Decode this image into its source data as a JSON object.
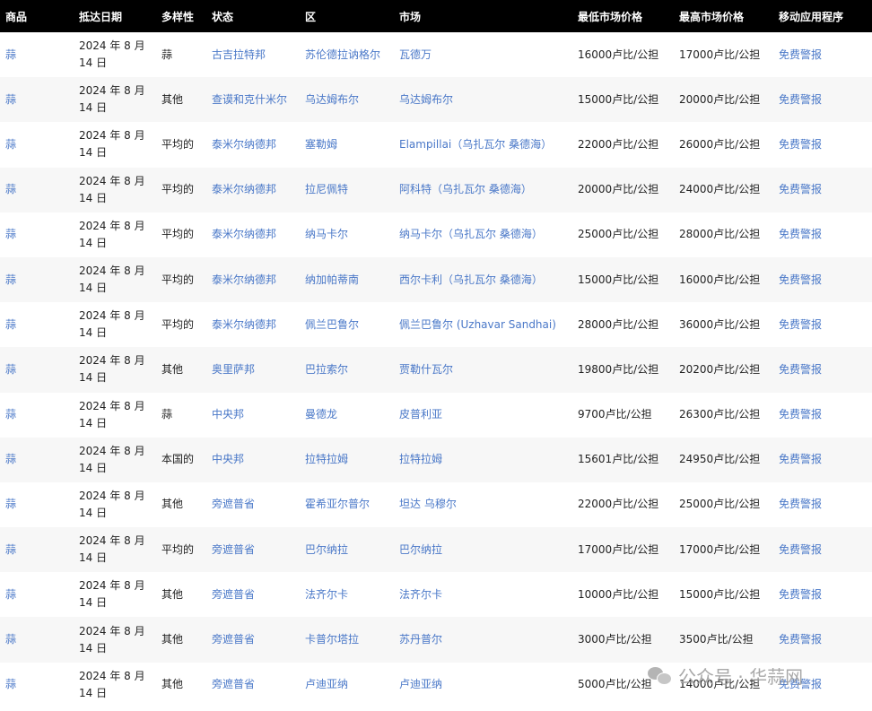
{
  "table": {
    "headers": {
      "commodity": "商品",
      "arrival_date": "抵达日期",
      "variety": "多样性",
      "state": "状态",
      "district": "区",
      "market": "市场",
      "min_price": "最低市场价格",
      "max_price": "最高市场价格",
      "mobile_app": "移动应用程序"
    },
    "rows": [
      {
        "commodity": "蒜",
        "arrival_date": "2024 年 8 月 14 日",
        "variety": "蒜",
        "state": "古吉拉特邦",
        "district": "苏伦德拉讷格尔",
        "market": "瓦德万",
        "min_price": "16000卢比/公担",
        "max_price": "17000卢比/公担",
        "mobile_app": "免费警报"
      },
      {
        "commodity": "蒜",
        "arrival_date": "2024 年 8 月 14 日",
        "variety": "其他",
        "state": "查谟和克什米尔",
        "district": "乌达姆布尔",
        "market": "乌达姆布尔",
        "min_price": "15000卢比/公担",
        "max_price": "20000卢比/公担",
        "mobile_app": "免费警报"
      },
      {
        "commodity": "蒜",
        "arrival_date": "2024 年 8 月 14 日",
        "variety": "平均的",
        "state": "泰米尔纳德邦",
        "district": "塞勒姆",
        "market": "Elampillai（乌扎瓦尔 桑德海）",
        "min_price": "22000卢比/公担",
        "max_price": "26000卢比/公担",
        "mobile_app": "免费警报"
      },
      {
        "commodity": "蒜",
        "arrival_date": "2024 年 8 月 14 日",
        "variety": "平均的",
        "state": "泰米尔纳德邦",
        "district": "拉尼佩特",
        "market": "阿科特（乌扎瓦尔 桑德海）",
        "min_price": "20000卢比/公担",
        "max_price": "24000卢比/公担",
        "mobile_app": "免费警报"
      },
      {
        "commodity": "蒜",
        "arrival_date": "2024 年 8 月 14 日",
        "variety": "平均的",
        "state": "泰米尔纳德邦",
        "district": "纳马卡尔",
        "market": "纳马卡尔（乌扎瓦尔 桑德海）",
        "min_price": "25000卢比/公担",
        "max_price": "28000卢比/公担",
        "mobile_app": "免费警报"
      },
      {
        "commodity": "蒜",
        "arrival_date": "2024 年 8 月 14 日",
        "variety": "平均的",
        "state": "泰米尔纳德邦",
        "district": "纳加帕蒂南",
        "market": "西尔卡利（乌扎瓦尔 桑德海）",
        "min_price": "15000卢比/公担",
        "max_price": "16000卢比/公担",
        "mobile_app": "免费警报"
      },
      {
        "commodity": "蒜",
        "arrival_date": "2024 年 8 月 14 日",
        "variety": "平均的",
        "state": "泰米尔纳德邦",
        "district": "佩兰巴鲁尔",
        "market": "佩兰巴鲁尔 (Uzhavar Sandhai)",
        "min_price": "28000卢比/公担",
        "max_price": "36000卢比/公担",
        "mobile_app": "免费警报"
      },
      {
        "commodity": "蒜",
        "arrival_date": "2024 年 8 月 14 日",
        "variety": "其他",
        "state": "奥里萨邦",
        "district": "巴拉索尔",
        "market": "贾勒什瓦尔",
        "min_price": "19800卢比/公担",
        "max_price": "20200卢比/公担",
        "mobile_app": "免费警报"
      },
      {
        "commodity": "蒜",
        "arrival_date": "2024 年 8 月 14 日",
        "variety": "蒜",
        "state": "中央邦",
        "district": "曼德龙",
        "market": "皮普利亚",
        "min_price": "9700卢比/公担",
        "max_price": "26300卢比/公担",
        "mobile_app": "免费警报"
      },
      {
        "commodity": "蒜",
        "arrival_date": "2024 年 8 月 14 日",
        "variety": "本国的",
        "state": "中央邦",
        "district": "拉特拉姆",
        "market": "拉特拉姆",
        "min_price": "15601卢比/公担",
        "max_price": "24950卢比/公担",
        "mobile_app": "免费警报"
      },
      {
        "commodity": "蒜",
        "arrival_date": "2024 年 8 月 14 日",
        "variety": "其他",
        "state": "旁遮普省",
        "district": "霍希亚尔普尔",
        "market": "坦达 乌穆尔",
        "min_price": "22000卢比/公担",
        "max_price": "25000卢比/公担",
        "mobile_app": "免费警报"
      },
      {
        "commodity": "蒜",
        "arrival_date": "2024 年 8 月 14 日",
        "variety": "平均的",
        "state": "旁遮普省",
        "district": "巴尔纳拉",
        "market": "巴尔纳拉",
        "min_price": "17000卢比/公担",
        "max_price": "17000卢比/公担",
        "mobile_app": "免费警报"
      },
      {
        "commodity": "蒜",
        "arrival_date": "2024 年 8 月 14 日",
        "variety": "其他",
        "state": "旁遮普省",
        "district": "法齐尔卡",
        "market": "法齐尔卡",
        "min_price": "10000卢比/公担",
        "max_price": "15000卢比/公担",
        "mobile_app": "免费警报"
      },
      {
        "commodity": "蒜",
        "arrival_date": "2024 年 8 月 14 日",
        "variety": "其他",
        "state": "旁遮普省",
        "district": "卡普尔塔拉",
        "market": "苏丹普尔",
        "min_price": "3000卢比/公担",
        "max_price": "3500卢比/公担",
        "mobile_app": "免费警报"
      },
      {
        "commodity": "蒜",
        "arrival_date": "2024 年 8 月 14 日",
        "variety": "其他",
        "state": "旁遮普省",
        "district": "卢迪亚纳",
        "market": "卢迪亚纳",
        "min_price": "5000卢比/公担",
        "max_price": "14000卢比/公担",
        "mobile_app": "免费警报"
      }
    ]
  },
  "watermark": {
    "text": "公众号 · 华蒜网",
    "icon": "wechat-icon"
  },
  "colors": {
    "header_bg": "#000000",
    "header_text": "#ffffff",
    "link": "#4a78c8",
    "row_alt": "#f7f7f7"
  }
}
